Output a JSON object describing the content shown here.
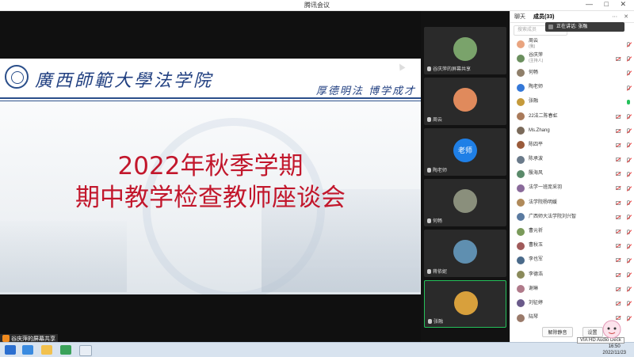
{
  "window": {
    "title": "腾讯会议",
    "controls": "— □ ✕"
  },
  "slide": {
    "university": "廣西師範大學法学院",
    "motto": "厚德明法 博学成才",
    "title_line1": "2022年秋季学期",
    "title_line2": "期中教学检查教师座谈会"
  },
  "share_tag": "谷庆萍的屏幕共享",
  "video_tiles": [
    {
      "name": "谷庆萍的屏幕共享",
      "avatar_color": "#7aa36b"
    },
    {
      "name": "周云",
      "avatar_color": "#e08a5c"
    },
    {
      "name": "陶老师",
      "avatar_text": "老师",
      "avatar_color": "#1f7fe6"
    },
    {
      "name": "何畅",
      "avatar_color": "#8a8f7c"
    },
    {
      "name": "蒋依妮",
      "avatar_color": "#5f8fb0"
    },
    {
      "name": "张融",
      "avatar_color": "#d8a03c"
    }
  ],
  "panel": {
    "tab_chat": "聊天",
    "tab_members": "成员(33)",
    "search_placeholder": "搜索成员",
    "speaking": "正在讲话: 张融",
    "mute_all": "解除静音",
    "settings": "设置",
    "members": [
      {
        "name": "周云",
        "sub": "(我)",
        "color": "#e9a47f",
        "mic": "off",
        "video": "none"
      },
      {
        "name": "谷庆萍",
        "sub": "(主持人)",
        "color": "#6b8f5e",
        "mic": "off",
        "video": "off"
      },
      {
        "name": "何畅",
        "color": "#8f7f6a",
        "mic": "off",
        "video": "none"
      },
      {
        "name": "陶老师",
        "color": "#3478d8",
        "mic": "off",
        "video": "none"
      },
      {
        "name": "张融",
        "color": "#c59a3b",
        "mic": "on",
        "video": "none"
      },
      {
        "name": "22法二陈春虹",
        "color": "#a97a5a",
        "mic": "off",
        "video": "off"
      },
      {
        "name": "Ms.Zhang",
        "color": "#7a6a5a",
        "mic": "off",
        "video": "off"
      },
      {
        "name": "陈四平",
        "color": "#9a5a3a",
        "mic": "off",
        "video": "off"
      },
      {
        "name": "陈承波",
        "color": "#6a7a8a",
        "mic": "off",
        "video": "off"
      },
      {
        "name": "殷海风",
        "color": "#5a8a6a",
        "mic": "off",
        "video": "off"
      },
      {
        "name": "法学一班庞采羽",
        "color": "#8a6a9a",
        "mic": "off",
        "video": "off"
      },
      {
        "name": "法学院杨明媛",
        "color": "#b08a5a",
        "mic": "off",
        "video": "off"
      },
      {
        "name": "广西师大法学院刘兴智",
        "color": "#5a7aa0",
        "mic": "off",
        "video": "off"
      },
      {
        "name": "曹元祈",
        "color": "#7a9a5a",
        "mic": "off",
        "video": "off"
      },
      {
        "name": "曹秋玉",
        "color": "#a05a5a",
        "mic": "off",
        "video": "off"
      },
      {
        "name": "李也军",
        "color": "#4a6a8a",
        "mic": "off",
        "video": "off"
      },
      {
        "name": "李德浩",
        "color": "#8a8a5a",
        "mic": "off",
        "video": "off"
      },
      {
        "name": "谢琳",
        "color": "#b07a8a",
        "mic": "off",
        "video": "off"
      },
      {
        "name": "刘征婷",
        "color": "#6a5a8a",
        "mic": "off",
        "video": "off"
      },
      {
        "name": "陆琴",
        "color": "#9a7a6a",
        "mic": "off",
        "video": "off"
      }
    ]
  },
  "tray": {
    "time": "16:50",
    "date": "2022/11/23"
  },
  "tooltip": "VIA HD Audio Deck"
}
